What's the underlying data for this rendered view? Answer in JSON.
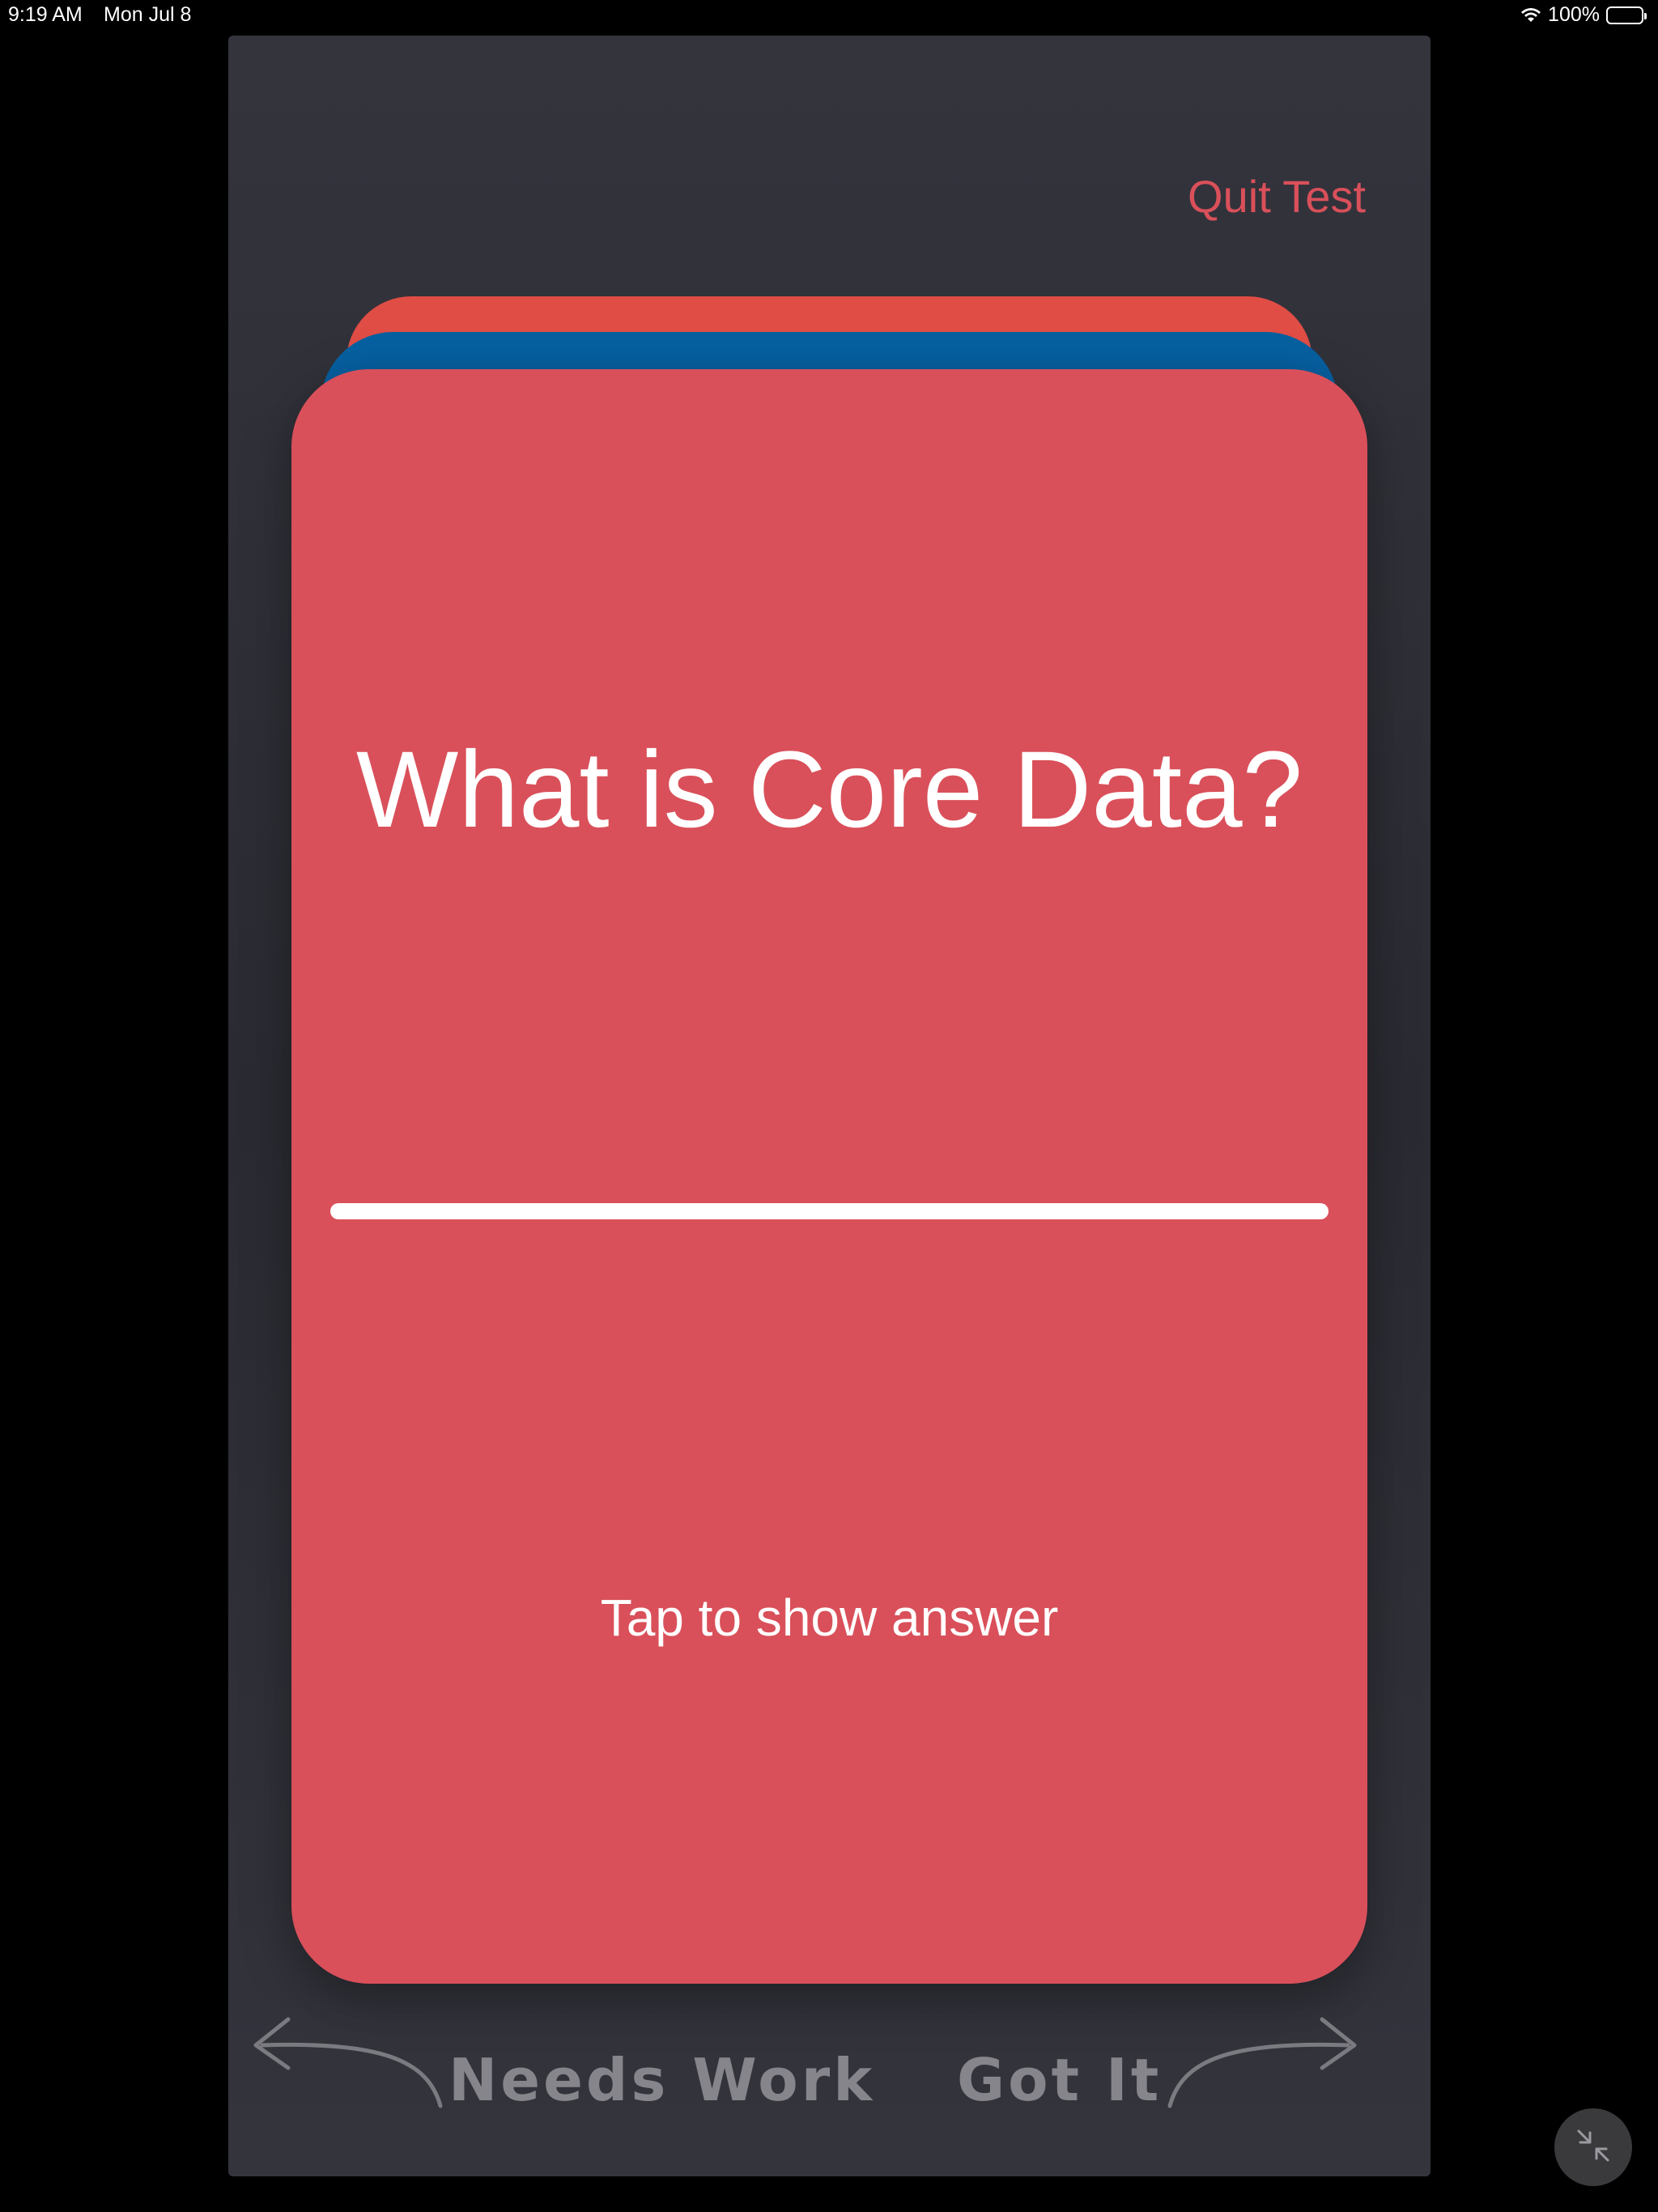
{
  "status_bar": {
    "time": "9:19 AM",
    "date": "Mon Jul 8",
    "battery": "100%"
  },
  "header": {
    "quit_label": "Quit Test"
  },
  "card": {
    "question": "What is Core Data?",
    "hint": "Tap to show answer",
    "color": "#d9505a"
  },
  "deck": {
    "back_card_colors": [
      "#df4d45",
      "#0660a0"
    ]
  },
  "swipe": {
    "left_label": "Needs Work",
    "right_label": "Got It"
  },
  "icons": {
    "wifi": "wifi-icon",
    "battery": "battery-icon",
    "left_arrow": "curved-arrow-left-icon",
    "right_arrow": "curved-arrow-right-icon",
    "collapse": "collapse-arrows-icon"
  }
}
